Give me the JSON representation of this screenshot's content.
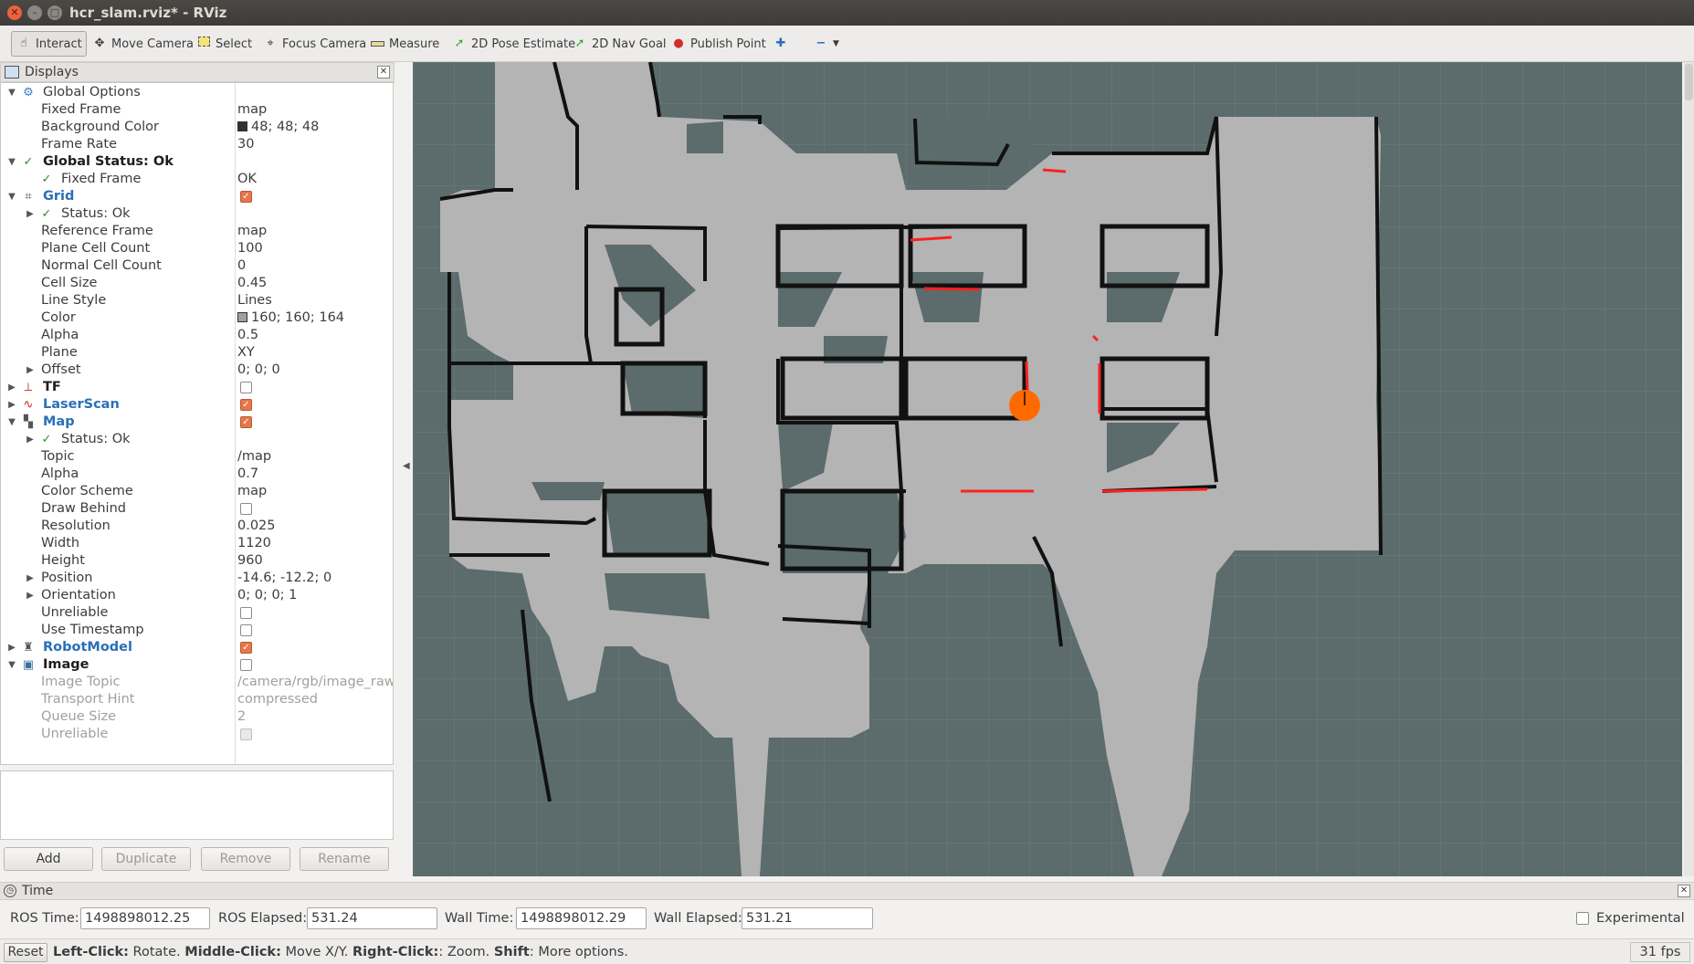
{
  "window": {
    "title": "hcr_slam.rviz* - RViz"
  },
  "toolbar": {
    "tools": [
      {
        "label": "Interact",
        "icon": "hand-icon"
      },
      {
        "label": "Move Camera",
        "icon": "move-camera-icon"
      },
      {
        "label": "Select",
        "icon": "select-icon"
      },
      {
        "label": "Focus Camera",
        "icon": "focus-camera-icon"
      },
      {
        "label": "Measure",
        "icon": "ruler-icon"
      },
      {
        "label": "2D Pose Estimate",
        "icon": "green-arrow-icon"
      },
      {
        "label": "2D Nav Goal",
        "icon": "green-arrow-icon"
      },
      {
        "label": "Publish Point",
        "icon": "map-pin-icon"
      }
    ]
  },
  "displays": {
    "title": "Displays",
    "rows": [
      {
        "label": "Global Options",
        "value": ""
      },
      {
        "label": "Fixed Frame",
        "value": "map"
      },
      {
        "label": "Background Color",
        "value": "48; 48; 48",
        "swatch": "#303030"
      },
      {
        "label": "Frame Rate",
        "value": "30"
      },
      {
        "label": "Global Status: Ok",
        "value": ""
      },
      {
        "label": "Fixed Frame",
        "value": "OK"
      },
      {
        "label": "Grid",
        "value": ""
      },
      {
        "label": "Status: Ok",
        "value": ""
      },
      {
        "label": "Reference Frame",
        "value": "map"
      },
      {
        "label": "Plane Cell Count",
        "value": "100"
      },
      {
        "label": "Normal Cell Count",
        "value": "0"
      },
      {
        "label": "Cell Size",
        "value": "0.45"
      },
      {
        "label": "Line Style",
        "value": "Lines"
      },
      {
        "label": "Color",
        "value": "160; 160; 164",
        "swatch": "#a0a0a4"
      },
      {
        "label": "Alpha",
        "value": "0.5"
      },
      {
        "label": "Plane",
        "value": "XY"
      },
      {
        "label": "Offset",
        "value": "0; 0; 0"
      },
      {
        "label": "TF",
        "value": ""
      },
      {
        "label": "LaserScan",
        "value": ""
      },
      {
        "label": "Map",
        "value": ""
      },
      {
        "label": "Status: Ok",
        "value": ""
      },
      {
        "label": "Topic",
        "value": "/map"
      },
      {
        "label": "Alpha",
        "value": "0.7"
      },
      {
        "label": "Color Scheme",
        "value": "map"
      },
      {
        "label": "Draw Behind",
        "value": ""
      },
      {
        "label": "Resolution",
        "value": "0.025"
      },
      {
        "label": "Width",
        "value": "1120"
      },
      {
        "label": "Height",
        "value": "960"
      },
      {
        "label": "Position",
        "value": "-14.6; -12.2; 0"
      },
      {
        "label": "Orientation",
        "value": "0; 0; 0; 1"
      },
      {
        "label": "Unreliable",
        "value": ""
      },
      {
        "label": "Use Timestamp",
        "value": ""
      },
      {
        "label": "RobotModel",
        "value": ""
      },
      {
        "label": "Image",
        "value": ""
      },
      {
        "label": "Image Topic",
        "value": "/camera/rgb/image_raw"
      },
      {
        "label": "Transport Hint",
        "value": "compressed"
      },
      {
        "label": "Queue Size",
        "value": "2"
      },
      {
        "label": "Unreliable",
        "value": ""
      }
    ],
    "buttons": {
      "add": "Add",
      "duplicate": "Duplicate",
      "remove": "Remove",
      "rename": "Rename"
    }
  },
  "time": {
    "title": "Time",
    "ros_time_label": "ROS Time:",
    "ros_time": "1498898012.25",
    "ros_elapsed_label": "ROS Elapsed:",
    "ros_elapsed": "531.24",
    "wall_time_label": "Wall Time:",
    "wall_time": "1498898012.29",
    "wall_elapsed_label": "Wall Elapsed:",
    "wall_elapsed": "531.21",
    "experimental_label": "Experimental"
  },
  "status": {
    "reset": "Reset",
    "hint_left": "Left-Click:",
    "hint_left_text": " Rotate. ",
    "hint_middle": "Middle-Click:",
    "hint_middle_text": " Move X/Y. ",
    "hint_right": "Right-Click:",
    "hint_right_text": ": Zoom. ",
    "hint_shift": "Shift",
    "hint_shift_text": ": More options.",
    "fps": "31 fps"
  },
  "colors": {
    "map_free": "#b4b4b4",
    "map_unknown": "#5c6b6b",
    "map_obstacle": "#111111",
    "laser": "#ff2020",
    "robot": "#ff6a00",
    "checkbox_on": "#e7774a"
  }
}
